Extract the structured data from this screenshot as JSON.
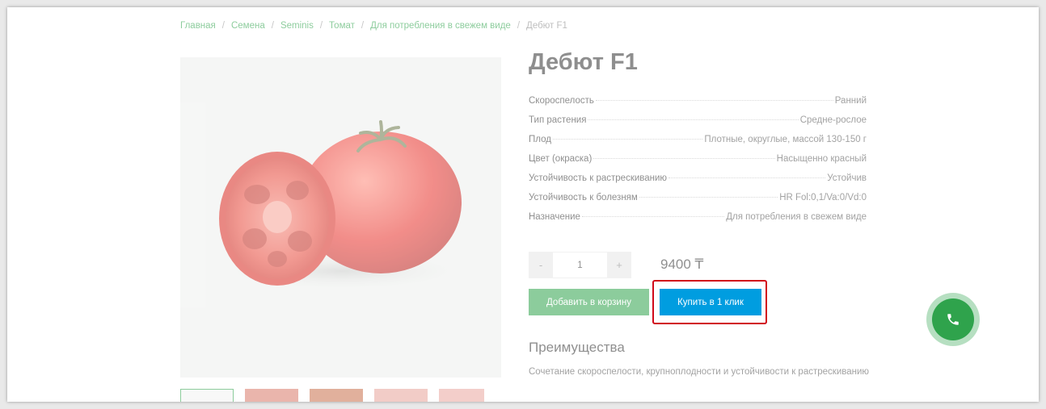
{
  "breadcrumb": {
    "items": [
      "Главная",
      "Семена",
      "Seminis",
      "Томат",
      "Для потребления в свежем виде"
    ],
    "current": "Дебют F1",
    "separator": "/"
  },
  "product": {
    "title": "Дебют F1",
    "image": "tomato-image",
    "thumbnails": [
      "tomato-thumb-1",
      "tomato-thumb-2",
      "tomato-thumb-3",
      "tomato-thumb-4",
      "tomato-thumb-5"
    ]
  },
  "specs": [
    {
      "label": "Скороспелость",
      "value": "Ранний"
    },
    {
      "label": "Тип растения",
      "value": "Средне-рослое"
    },
    {
      "label": "Плод",
      "value": "Плотные, округлые, массой 130-150 г"
    },
    {
      "label": "Цвет (окраска)",
      "value": "Насыщенно красный"
    },
    {
      "label": "Устойчивость к растрескиванию",
      "value": "Устойчив"
    },
    {
      "label": "Устойчивость к болезням",
      "value": "HR Fol:0,1/Va:0/Vd:0"
    },
    {
      "label": "Назначение",
      "value": "Для потребления в свежем виде"
    }
  ],
  "quantity": {
    "minus": "-",
    "value": "1",
    "plus": "+"
  },
  "price": "9400 ₸",
  "buttons": {
    "add_to_cart": "Добавить в корзину",
    "buy_one_click": "Купить в 1 клик"
  },
  "advantages": {
    "title": "Преимущества",
    "text": "Сочетание скороспелости, крупноплодности и устойчивости к растрескиванию"
  },
  "call_button": {
    "icon": "phone-icon"
  },
  "colors": {
    "accent_green": "#2fa34c",
    "buy_blue": "#009de0",
    "highlight_red": "#d10a1a"
  }
}
